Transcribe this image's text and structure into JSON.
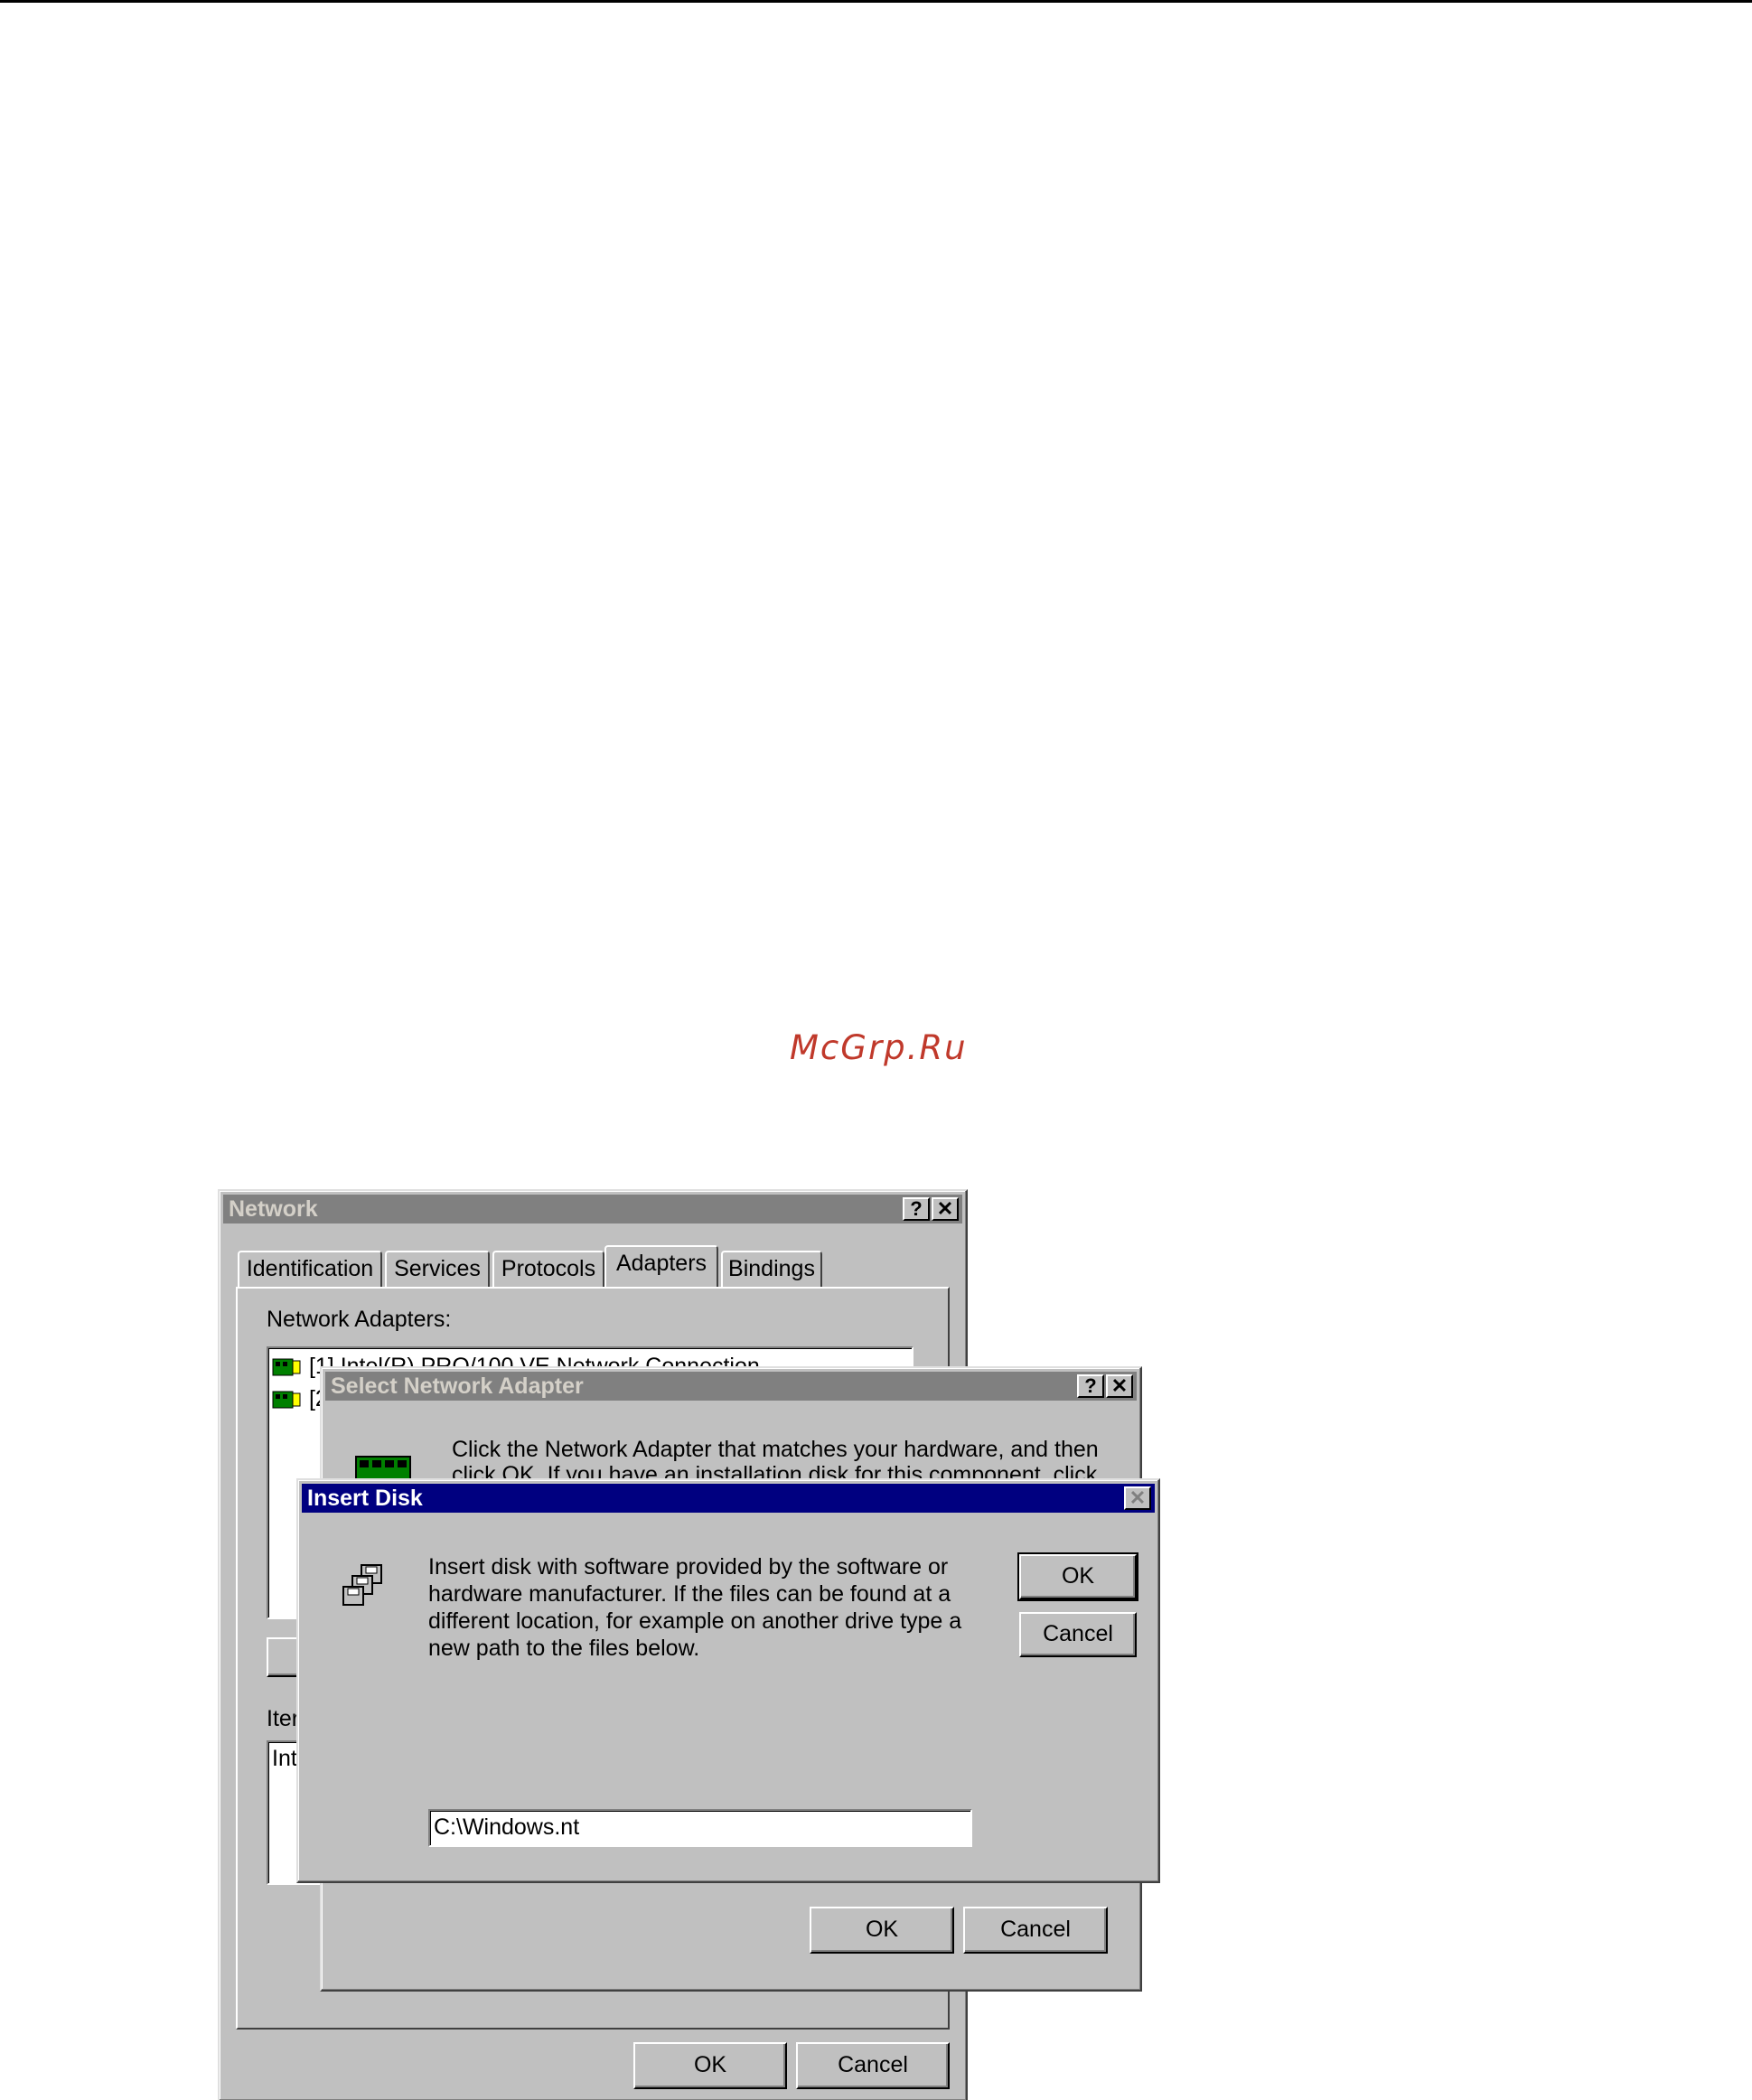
{
  "watermark": "McGrp.Ru",
  "network": {
    "title": "Network",
    "help_glyph": "?",
    "close_glyph": "✕",
    "tabs": [
      "Identification",
      "Services",
      "Protocols",
      "Adapters",
      "Bindings"
    ],
    "selected_tab": "Adapters",
    "adapters_label": "Network Adapters:",
    "adapters": [
      "[1] Intel(R) PRO/100 VE Network Connection",
      "[2"
    ],
    "item_notes_label": "Iter",
    "item_notes_value": "Int",
    "ok_label": "OK",
    "cancel_label": "Cancel"
  },
  "select_adapter": {
    "title": "Select Network Adapter",
    "help_glyph": "?",
    "close_glyph": "✕",
    "description_line1": "Click the Network Adapter that matches your hardware, and then",
    "description_line2": "click OK.  If you have an installation disk for this component, click",
    "ok_label": "OK",
    "cancel_label": "Cancel"
  },
  "insert_disk": {
    "title": "Insert Disk",
    "close_glyph": "✕",
    "message_line1": "Insert disk with software provided by the software or",
    "message_line2": "hardware manufacturer.  If the files can be found at a",
    "message_line3": "different location, for example on another drive type a",
    "message_line4": "new path to the files below.",
    "path_value": "C:\\Windows.nt",
    "ok_label": "OK",
    "cancel_label": "Cancel"
  }
}
